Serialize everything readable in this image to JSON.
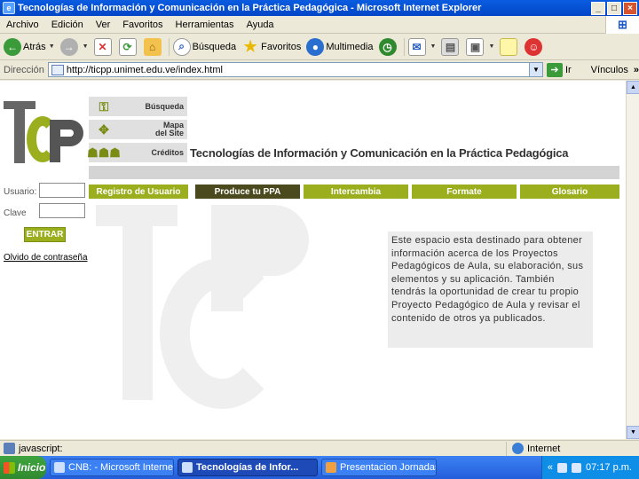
{
  "window": {
    "title": "Tecnologías de Información y Comunicación en la Práctica Pedagógica - Microsoft Internet Explorer",
    "icon": "ie-icon",
    "controls": [
      "_",
      "□",
      "×"
    ]
  },
  "menubar": {
    "items": [
      "Archivo",
      "Edición",
      "Ver",
      "Favoritos",
      "Herramientas",
      "Ayuda"
    ]
  },
  "toolbar": {
    "back_label": "Atrás",
    "search_label": "Búsqueda",
    "favorites_label": "Favoritos",
    "multimedia_label": "Multimedia"
  },
  "address": {
    "label": "Dirección",
    "url": "http://ticpp.unimet.edu.ve/index.html",
    "go_label": "Ir",
    "links_label": "Vínculos"
  },
  "page": {
    "logo_text": "TICP",
    "graphic_links": [
      "Búsqueda",
      "Mapa del Site",
      "Créditos"
    ],
    "site_title": "Tecnologías de Información y Comunicación en la Práctica Pedagógica",
    "nav": [
      "Registro de Usuario",
      "Produce tu PPA",
      "Intercambia",
      "Formate",
      "Glosario"
    ],
    "login": {
      "user_label": "Usuario:",
      "password_label": "Clave",
      "user_value": "",
      "password_value": "",
      "enter_label": "ENTRAR",
      "forgot_label": "Olvido de contraseña"
    },
    "info_text": "Este espacio esta destinado para obtener información acerca de los Proyectos Pedagógicos de Aula, su elaboración, sus elementos y su aplicación. También tendrás la oportunidad de crear tu propio Proyecto Pedagógico de Aula y revisar el contenido de otros ya publicados."
  },
  "statusbar": {
    "left_text": "javascript:",
    "zone_text": "Internet"
  },
  "taskbar": {
    "start_label": "Inicio",
    "tasks": [
      "CNB: - Microsoft Interne...",
      "Tecnologías de Infor...",
      "Presentacion Jornadas M..."
    ],
    "clock": "07:17 p.m."
  },
  "colors": {
    "accent_green": "#9aae1e",
    "dark_olive": "#4a4a1e",
    "xp_blue": "#245edb"
  }
}
